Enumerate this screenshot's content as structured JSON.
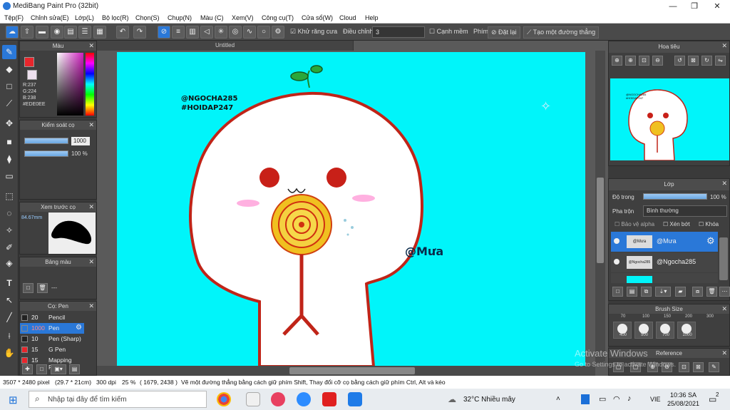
{
  "window": {
    "title": "MediBang Paint Pro (32bit)",
    "controls": [
      "—",
      "❐",
      "✕"
    ]
  },
  "menu": [
    "Tệp(F)",
    "Chỉnh sửa(E)",
    "Lớp(L)",
    "Bộ lọc(R)",
    "Chọn(S)",
    "Chụp(N)",
    "Màu (C)",
    "Xem(V)",
    "Công cụ(T)",
    "Cửa sổ(W)",
    "Cloud",
    "Help"
  ],
  "toolbar": {
    "antialias_label": "Khử răng cưa",
    "adjust_label": "Điều chỉnh",
    "adjust_value": "3",
    "smooth_edges_label": "Cạnh mềm",
    "key_label": "Phím",
    "reset_label": "Đặt lại",
    "straight_line_label": "Tạo một đường thẳng"
  },
  "color_panel": {
    "title": "Màu",
    "r": "R:237",
    "g": "G:224",
    "b": "B:238",
    "hex": "#EDE0EE",
    "primary_color": "#e8262c",
    "secondary_color": "#ede0ee"
  },
  "brush_control": {
    "title": "Kiểm soát cọ",
    "size_value": "1000",
    "opacity_value": "100 %"
  },
  "brush_preview": {
    "title": "Xem trước cọ",
    "size_label": "84.67mm"
  },
  "palette": {
    "title": "Bảng màu",
    "dash": "---"
  },
  "brush_list": {
    "title": "Cọ: Pen",
    "items": [
      {
        "size": "20",
        "name": "Pencil",
        "color": "#222222"
      },
      {
        "size": "1000",
        "name": "Pen",
        "color": "#2a78d8"
      },
      {
        "size": "10",
        "name": "Pen (Sharp)",
        "color": "#222222"
      },
      {
        "size": "15",
        "name": "G Pen",
        "color": "#e8262c"
      },
      {
        "size": "15",
        "name": "Mapping Pen",
        "color": "#e8262c"
      }
    ]
  },
  "document": {
    "tab": "Untitled",
    "handle1": "@NGOCHA285",
    "handle2": "#HOIDAP247",
    "signature": "@Mưa"
  },
  "navigator": {
    "title": "Hoa tiêu",
    "thumb_text1": "@NGOCHA285",
    "thumb_text2": "#HOIDAP247"
  },
  "layers": {
    "title": "Lớp",
    "opacity_label": "Độ trong",
    "opacity_value": "100 %",
    "blend_label": "Pha trộn",
    "blend_value": "Bình thường",
    "protect_alpha": "Bảo vệ alpha",
    "clip": "Xén bớt",
    "lock": "Khóa",
    "items": [
      {
        "thumb": "@Mưa",
        "name": "@Mưa"
      },
      {
        "thumb": "@Ngocha285",
        "name": "@Ngocha285"
      }
    ]
  },
  "brush_size": {
    "title": "Brush Size",
    "top_values": [
      "70",
      "100",
      "150",
      "200",
      "300"
    ],
    "values": [
      "400",
      "500",
      "700",
      "1000"
    ]
  },
  "reference": {
    "title": "Reference"
  },
  "watermark": {
    "line1": "Activate Windows",
    "line2": "Go to Settings to activate Windows."
  },
  "status": {
    "size": "3507 * 2480 pixel",
    "dimensions": "(29.7 * 21cm)",
    "dpi": "300 dpi",
    "zoom": "25 %",
    "coords": "( 1679, 2438 )",
    "hint": "Vẽ một đường thẳng bằng cách giữ phím Shift, Thay đổi cỡ cọ bằng cách giữ phím Ctrl, Alt và kéo"
  },
  "taskbar": {
    "search_placeholder": "Nhập tại đây để tìm kiếm",
    "weather": "32°C  Nhiều mây",
    "lang": "VIE",
    "time": "10:36 SA",
    "date": "25/08/2021",
    "notifications": "2"
  }
}
